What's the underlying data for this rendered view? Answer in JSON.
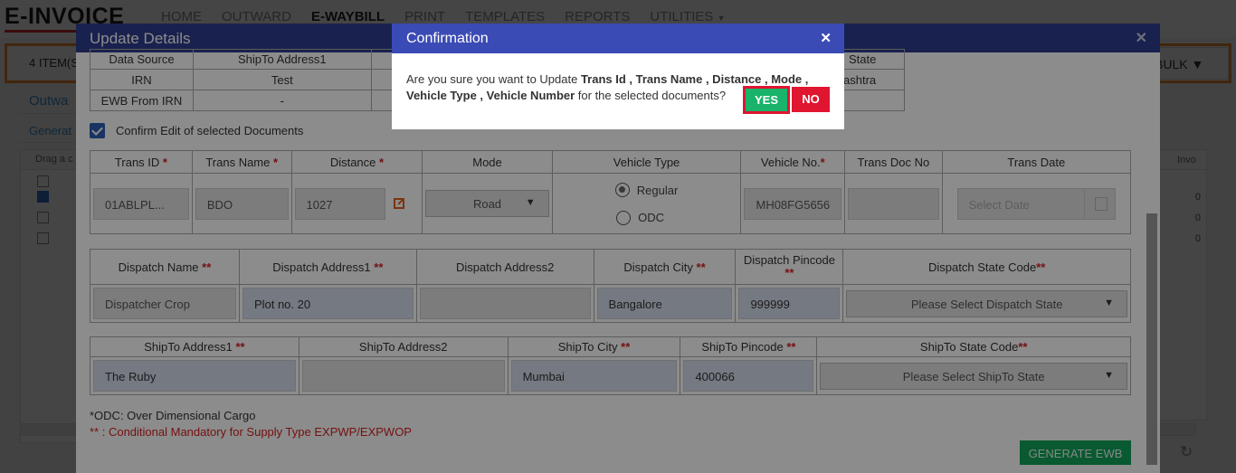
{
  "app": {
    "logo": "E-INVOICE",
    "nav": [
      "HOME",
      "OUTWARD",
      "E-WAYBILL",
      "PRINT",
      "TEMPLATES",
      "REPORTS",
      "UTILITIES"
    ],
    "active_nav": "E-WAYBILL",
    "items_count": "4 ITEM(S",
    "bulk_label": "BULK",
    "tab_outward": "Outwa",
    "tab_generate": "Generat",
    "grid_header": "Drag a c",
    "right_grid_header": "Invo",
    "right_grid_values": [
      "0",
      "0",
      "0"
    ]
  },
  "modal": {
    "title": "Update Details",
    "source_table": {
      "headers": [
        "Data Source",
        "ShipTo Address1",
        "State"
      ],
      "rows": [
        {
          "source": "IRN",
          "shipto": "Test",
          "state": "ashtra"
        },
        {
          "source": "EWB From IRN",
          "shipto": "-",
          "state": ""
        }
      ]
    },
    "confirm_edit_label": "Confirm Edit of selected Documents",
    "trans": {
      "headers": [
        "Trans ID",
        "Trans Name",
        "Distance",
        "Mode",
        "Vehicle Type",
        "Vehicle No.",
        "Trans Doc No",
        "Trans Date"
      ],
      "trans_id": "01ABLPL...",
      "trans_name": "BDO",
      "distance": "1027",
      "mode": "Road",
      "vehicle_type_options": [
        "Regular",
        "ODC"
      ],
      "vehicle_type_selected": "Regular",
      "vehicle_no": "MH08FG5656",
      "trans_doc_no": "",
      "trans_date_placeholder": "Select Date"
    },
    "dispatch": {
      "headers": [
        "Dispatch Name",
        "Dispatch Address1",
        "Dispatch Address2",
        "Dispatch City",
        "Dispatch Pincode",
        "Dispatch State Code"
      ],
      "name": "Dispatcher Crop",
      "address1": "Plot no. 20",
      "address2": "",
      "city": "Bangalore",
      "pincode": "999999",
      "state": "Please Select Dispatch State"
    },
    "shipto": {
      "headers": [
        "ShipTo Address1",
        "ShipTo Address2",
        "ShipTo City",
        "ShipTo Pincode",
        "ShipTo State Code"
      ],
      "address1": "The Ruby",
      "address2": "",
      "city": "Mumbai",
      "pincode": "400066",
      "state": "Please Select ShipTo State"
    },
    "note_odc": "*ODC: Over Dimensional Cargo",
    "note_mandatory": "** : Conditional Mandatory for Supply Type EXPWP/EXPWOP",
    "generate_label": "GENERATE EWB"
  },
  "confirmation": {
    "title": "Confirmation",
    "msg_prefix": "Are you sure you want to Update ",
    "msg_fields_line1": "Trans Id , Trans Name , Distance , Mode ,",
    "msg_fields_line2": "Vehicle Type , Vehicle Number",
    "msg_suffix": " for the selected documents?",
    "yes_label": "YES",
    "no_label": "NO"
  },
  "colors": {
    "modal_header": "#2e3c8e",
    "confirm_header": "#3b4bb5",
    "yes": "#19b36b",
    "no": "#e01530",
    "generate": "#11a35a",
    "orange_border": "#ef8d34"
  }
}
